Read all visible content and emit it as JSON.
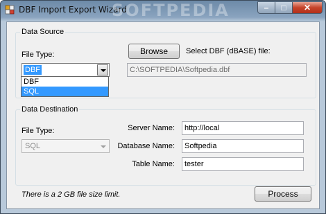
{
  "window": {
    "title": "DBF Import Export Wizard",
    "watermark": "SOFTPEDIA",
    "controls": {
      "minimize": "–",
      "maximize": "□",
      "close": "✕"
    }
  },
  "data_source": {
    "legend": "Data Source",
    "file_type_label": "File Type:",
    "file_type_value": "DBF",
    "file_type_options": [
      "DBF",
      "SQL"
    ],
    "highlighted_option": "SQL",
    "browse_label": "Browse",
    "select_label": "Select DBF (dBASE) file:",
    "file_path": "C:\\SOFTPEDIA\\Softpedia.dbf"
  },
  "data_destination": {
    "legend": "Data Destination",
    "file_type_label": "File Type:",
    "file_type_value": "SQL",
    "server_label": "Server Name:",
    "server_value": "http://local",
    "database_label": "Database Name:",
    "database_value": "Softpedia",
    "table_label": "Table Name:",
    "table_value": "tester"
  },
  "footer": {
    "note": "There is a 2 GB file size limit.",
    "process_label": "Process"
  },
  "colors": {
    "selection": "#3399ff",
    "close_button": "#c5432a"
  },
  "icons": {
    "app": "dbf-app-icon",
    "dropdown": "chevron-down-icon"
  }
}
